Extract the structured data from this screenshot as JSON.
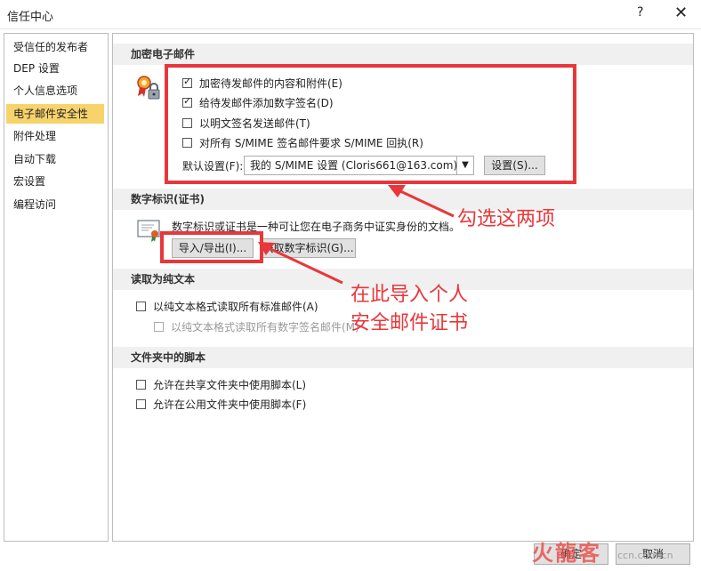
{
  "window": {
    "title": "信任中心",
    "help_label": "?",
    "close_label": "✕"
  },
  "sidebar": {
    "items": [
      {
        "label": "受信任的发布者"
      },
      {
        "label": "DEP 设置"
      },
      {
        "label": "个人信息选项"
      },
      {
        "label": "电子邮件安全性",
        "active": true
      },
      {
        "label": "附件处理"
      },
      {
        "label": "自动下载"
      },
      {
        "label": "宏设置"
      },
      {
        "label": "编程访问"
      }
    ]
  },
  "encrypted": {
    "header": "加密电子邮件",
    "options": [
      {
        "label": "加密待发邮件的内容和附件(E)",
        "checked": true
      },
      {
        "label": "给待发邮件添加数字签名(D)",
        "checked": true
      },
      {
        "label": "以明文签名发送邮件(T)",
        "checked": false
      },
      {
        "label": "对所有 S/MIME 签名邮件要求 S/MIME 回执(R)",
        "checked": false
      }
    ],
    "default_setting_label": "默认设置(F):",
    "default_setting_value": "我的 S/MIME 设置 (Cloris661@163.com)",
    "settings_button": "设置(S)..."
  },
  "digital_id": {
    "header": "数字标识(证书)",
    "description": "数字标识或证书是一种可让您在电子商务中证实身份的文档。",
    "import_export_button": "导入/导出(I)...",
    "get_id_button": "获取数字标识(G)..."
  },
  "plain_text": {
    "header": "读取为纯文本",
    "options": [
      {
        "label": "以纯文本格式读取所有标准邮件(A)",
        "checked": false,
        "disabled": false
      },
      {
        "label": "以纯文本格式读取所有数字签名邮件(M)",
        "checked": false,
        "disabled": true
      }
    ]
  },
  "folder_scripts": {
    "header": "文件夹中的脚本",
    "options": [
      {
        "label": "允许在共享文件夹中使用脚本(L)",
        "checked": false
      },
      {
        "label": "允许在公用文件夹中使用脚本(F)",
        "checked": false
      }
    ]
  },
  "annotations": {
    "check_these_two": "勾选这两项",
    "import_line1": "在此导入个人",
    "import_line2": "安全邮件证书"
  },
  "footer": {
    "ok_label": "确定",
    "cancel_label": "取消"
  },
  "watermark": {
    "text": "火龍客",
    "site": "ccn.com.cn"
  },
  "colors": {
    "annotation_red": "#e8373a",
    "active_item": "#f7d36c",
    "section_bg": "#f0f0f0"
  },
  "icons": {
    "encryption": "lock-ribbon-icon",
    "certificate": "certificate-icon"
  }
}
